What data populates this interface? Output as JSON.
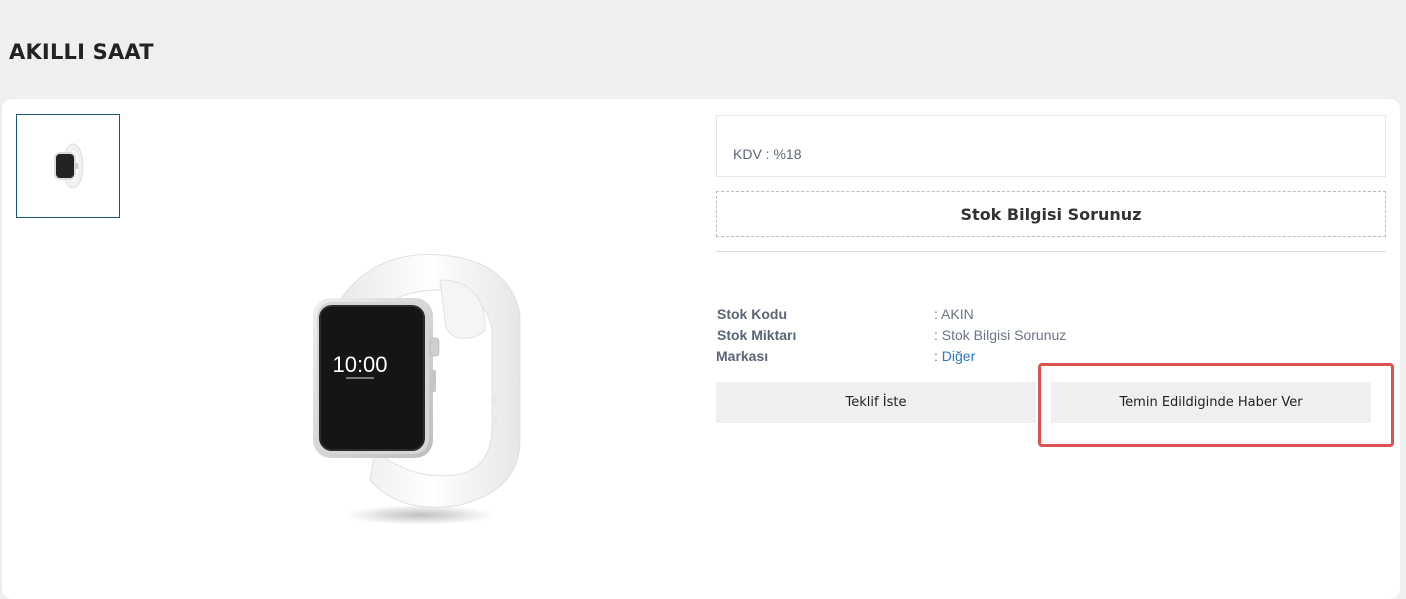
{
  "page": {
    "title": "AKILLI SAAT"
  },
  "product": {
    "kdv_label": "KDV :",
    "kdv_value": "%18",
    "stock_ask": "Stok Bilgisi Sorunuz",
    "watch_time": "10:00"
  },
  "info": [
    {
      "label": "Stok Kodu",
      "value": "AKIN"
    },
    {
      "label": "Stok Miktarı",
      "value": "Stok Bilgisi Sorunuz"
    },
    {
      "label": "Markası",
      "value": "Diğer"
    }
  ],
  "actions": {
    "quote": "Teklif İste",
    "notify": "Temin Edildiginde Haber Ver"
  },
  "colors": {
    "highlight": "#d9534f",
    "thumb_border": "#1c5a7a",
    "link": "#2a7ac8"
  }
}
